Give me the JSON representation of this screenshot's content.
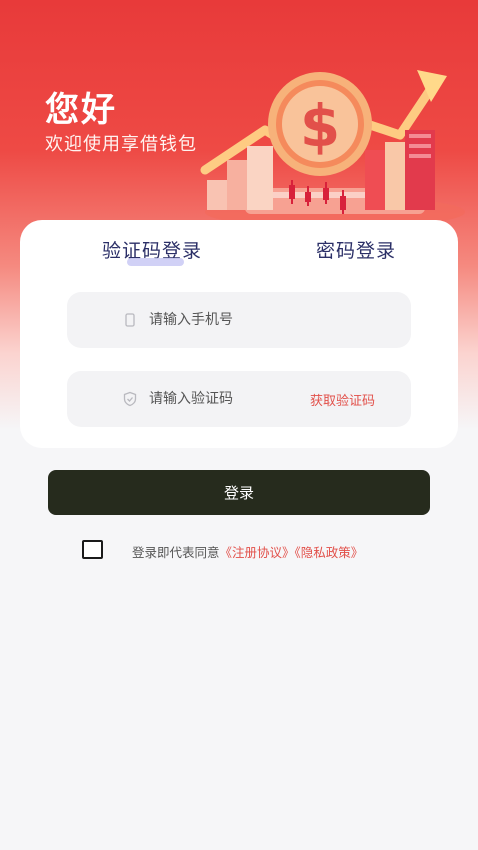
{
  "header": {
    "greeting": "您好",
    "welcome": "欢迎使用享借钱包"
  },
  "tabs": {
    "code_login": "验证码登录",
    "password_login": "密码登录",
    "active": "code_login"
  },
  "form": {
    "phone_placeholder": "请输入手机号",
    "phone_value": "",
    "code_placeholder": "请输入验证码",
    "code_value": "",
    "get_code_label": "获取验证码"
  },
  "login_button": "登录",
  "agreement": {
    "checked": false,
    "prefix": "登录即代表同意",
    "register_link": "《注册协议》",
    "privacy_link": "《隐私政策》"
  },
  "colors": {
    "brand_red": "#e83a3a",
    "link_red": "#e2504a",
    "button_dark": "#262b1d",
    "tab_text": "#2b2f67"
  },
  "icons": {
    "phone": "phone-icon",
    "shield": "shield-icon",
    "coin": "dollar-coin-icon"
  }
}
